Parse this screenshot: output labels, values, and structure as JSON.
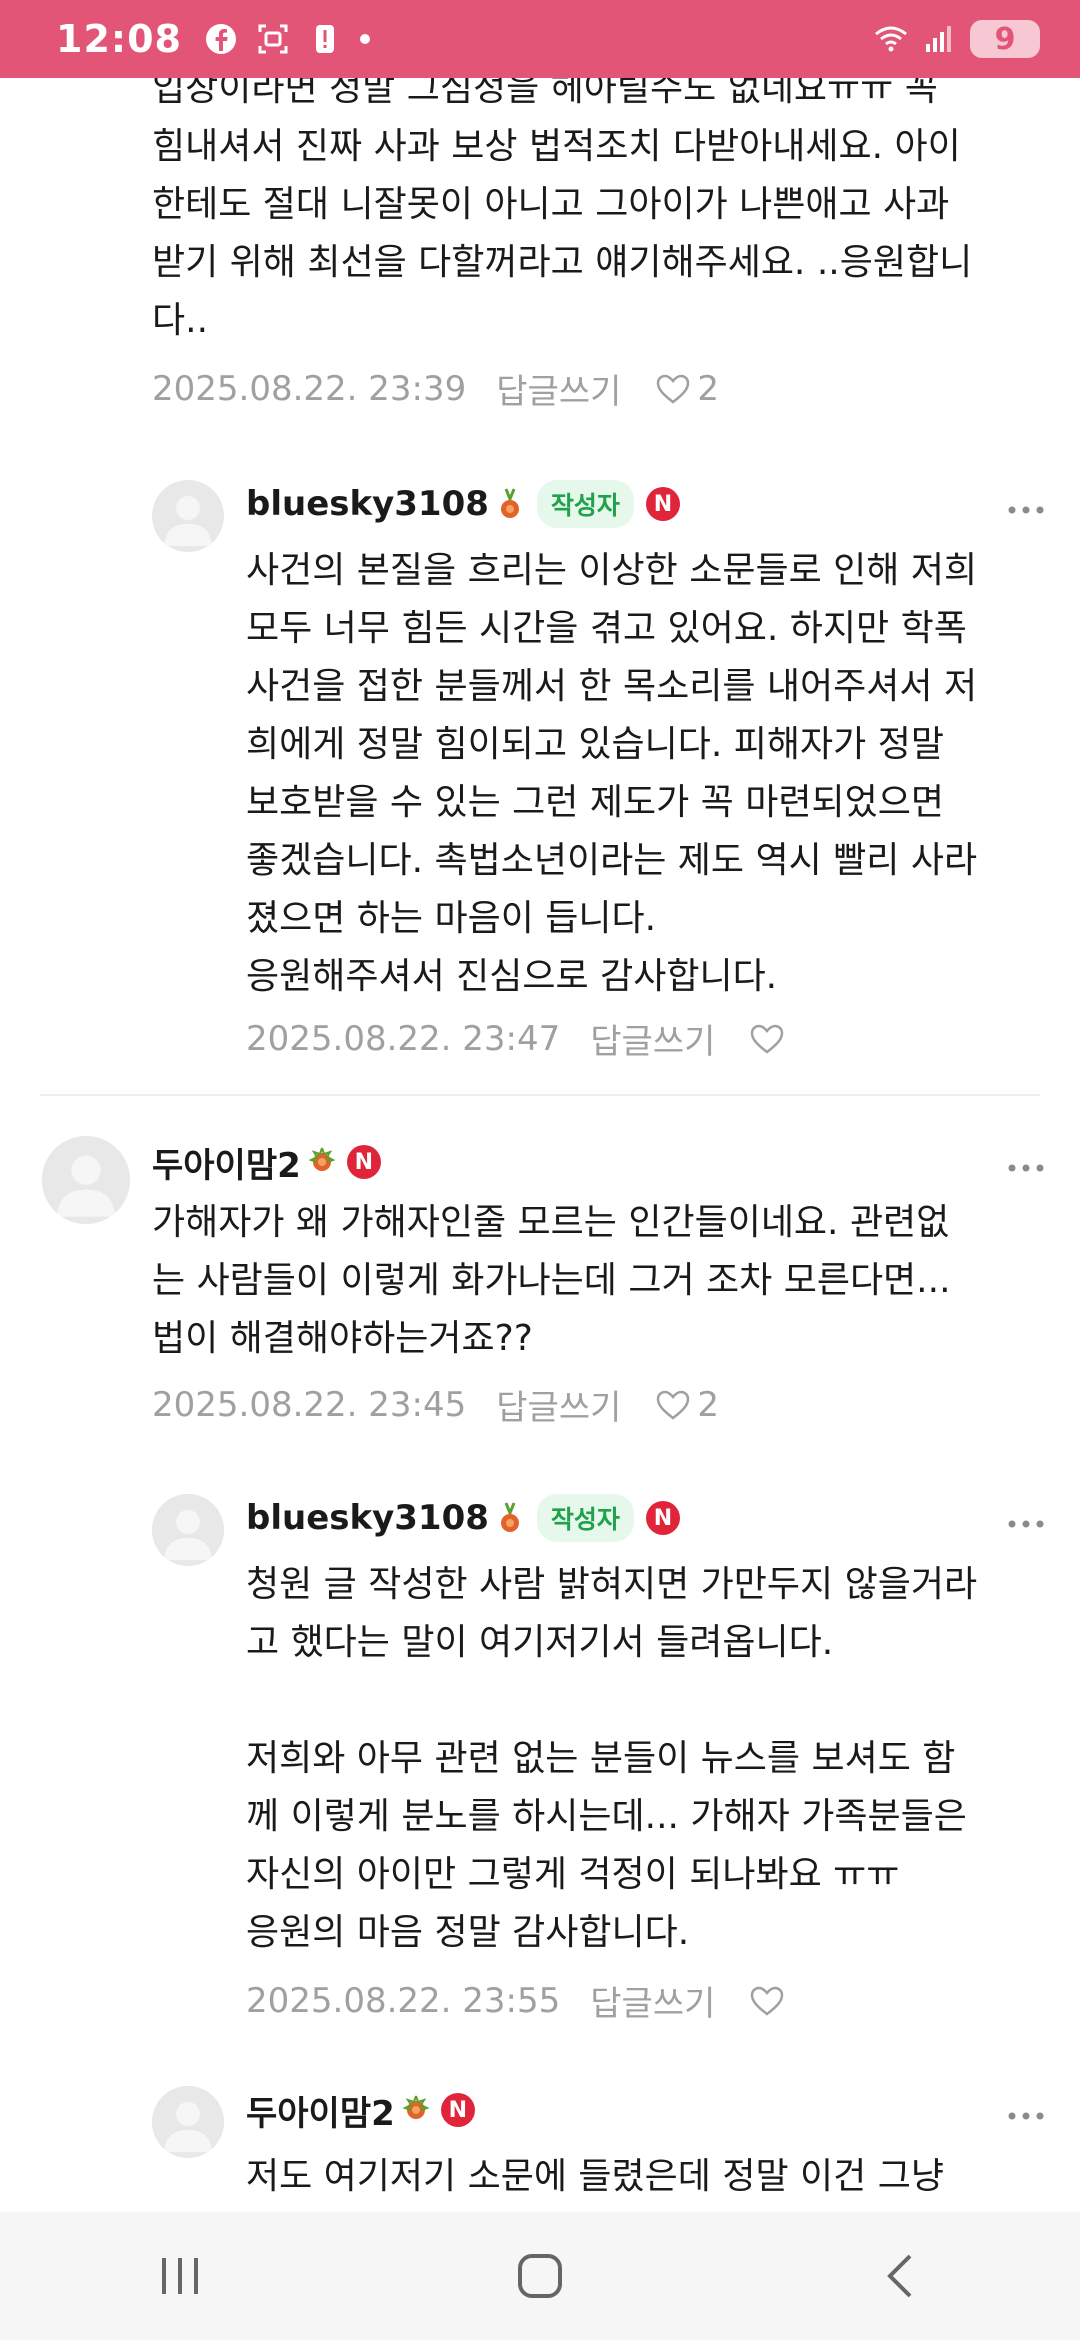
{
  "status_bar": {
    "time": "12:08",
    "battery": "9",
    "accent_color": "#e25577"
  },
  "comments": [
    {
      "text": "입장이라면 정말 그심정을 헤아릴수도 없네요ㅠㅠ 꼭\n힘내셔서 진짜 사과 보상 법적조치 다받아내세요. 아이\n한테도 절대 니잘못이 아니고 그아이가 나쁜애고 사과\n받기 위해 최선을 다할꺼라고 얘기해주세요. ..응원합니\n다..",
      "date": "2025.08.22. 23:39",
      "reply": "답글쓰기",
      "likes": "2"
    },
    {
      "nickname": "bluesky3108",
      "writer_badge": "작성자",
      "n_badge": "N",
      "text": "사건의 본질을 흐리는 이상한 소문들로 인해 저희\n모두 너무 힘든 시간을 겪고 있어요. 하지만 학폭\n사건을 접한 분들께서 한 목소리를 내어주셔서 저\n희에게 정말 힘이되고 있습니다. 피해자가 정말\n보호받을 수 있는 그런 제도가 꼭 마련되었으면\n좋겠습니다. 촉법소년이라는 제도 역시 빨리 사라\n졌으면 하는 마음이 듭니다.\n응원해주셔서 진심으로 감사합니다.",
      "date": "2025.08.22. 23:47",
      "reply": "답글쓰기"
    },
    {
      "nickname": "두아이맘2",
      "n_badge": "N",
      "text": "가해자가 왜 가해자인줄 모르는 인간들이네요. 관련없\n는 사람들이 이렇게 화가나는데 그거 조차 모른다면...\n법이 해결해야하는거죠??",
      "date": "2025.08.22. 23:45",
      "reply": "답글쓰기",
      "likes": "2"
    },
    {
      "nickname": "bluesky3108",
      "writer_badge": "작성자",
      "n_badge": "N",
      "text": "청원 글 작성한 사람 밝혀지면 가만두지 않을거라\n고 했다는 말이 여기저기서 들려옵니다.\n\n저희와 아무 관련 없는 분들이 뉴스를 보셔도 함\n께 이렇게 분노를 하시는데... 가해자 가족분들은\n자신의 아이만 그렇게 걱정이 되나봐요 ㅠㅠ\n응원의 마음 정말 감사합니다.",
      "date": "2025.08.22. 23:55",
      "reply": "답글쓰기"
    },
    {
      "nickname": "두아이맘2",
      "n_badge": "N",
      "text": "저도 여기저기 소문에 들렸은데 정말 이건 그냥"
    }
  ],
  "more_icon": "more-dots-icon",
  "navigation": {
    "recent": "recent-apps-icon",
    "home": "home-icon",
    "back": "back-icon"
  }
}
